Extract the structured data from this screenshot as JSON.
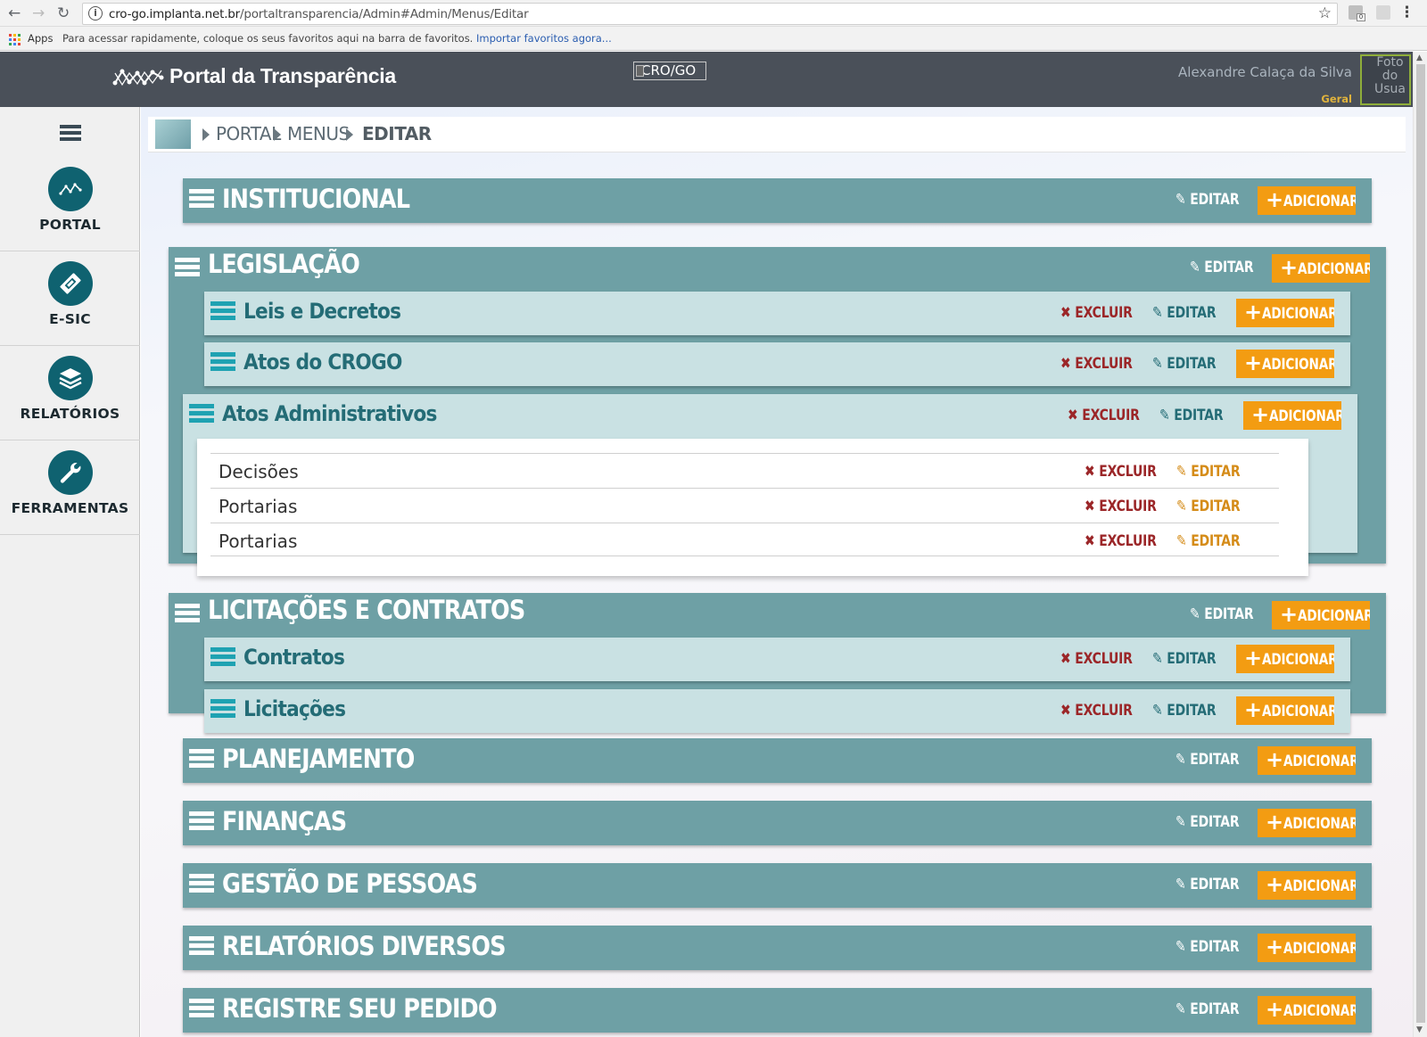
{
  "browser": {
    "url_host": "cro-go.implanta.net.br",
    "url_path": "/portaltransparencia/Admin#Admin/Menus/Editar",
    "bookmark_apps": "Apps",
    "bookmark_hint": "Para acessar rapidamente, coloque os seus favoritos aqui na barra de favoritos.",
    "bookmark_link": "Importar favoritos agora...",
    "ext_badge": "0"
  },
  "header": {
    "title": "Portal da Transparência",
    "logo_alt": "CRO/GO",
    "user_name": "Alexandre Calaça da Silva",
    "user_role": "Geral",
    "photo_alt": "Foto do Usua"
  },
  "sidebar": {
    "items": [
      {
        "label": "PORTAL"
      },
      {
        "label": "E-SIC"
      },
      {
        "label": "RELATÓRIOS"
      },
      {
        "label": "FERRAMENTAS"
      }
    ]
  },
  "breadcrumb": {
    "items": [
      "PORTAL",
      "MENUS",
      "EDITAR"
    ]
  },
  "actions": {
    "edit": "EDITAR",
    "add": "ADICIONAR",
    "delete": "EXCLUIR"
  },
  "sections": {
    "institucional": "INSTITUCIONAL",
    "legislacao": {
      "title": "LEGISLAÇÃO",
      "children": [
        "Leis e Decretos",
        "Atos do CROGO",
        "Atos Administrativos"
      ],
      "leaves": [
        "Decisões",
        "Portarias",
        "Portarias"
      ]
    },
    "licitacoes": {
      "title": "LICITAÇÕES E CONTRATOS",
      "children": [
        "Contratos",
        "Licitações"
      ]
    },
    "planejamento": "PLANEJAMENTO",
    "financas": "FINANÇAS",
    "gestao": "GESTÃO DE PESSOAS",
    "relatorios": "RELATÓRIOS DIVERSOS",
    "registre": "REGISTRE SEU PEDIDO"
  },
  "colors": {
    "topbar": "#4a5059",
    "section": "#6ea0a5",
    "subsection": "#c9e1e3",
    "add_button": "#f39c12",
    "delete": "#9b2628",
    "leaf_edit": "#d58c19",
    "sidebar_circle": "#0f6270"
  }
}
